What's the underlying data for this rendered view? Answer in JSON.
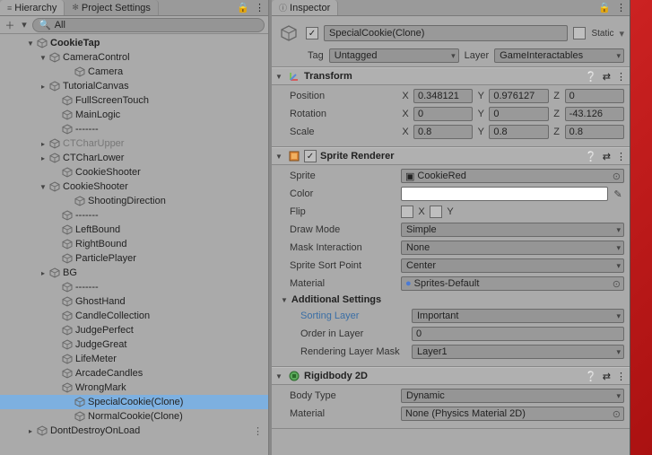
{
  "left": {
    "tab1": "Hierarchy",
    "tab2": "Project Settings",
    "search_placeholder": "All",
    "tree": [
      {
        "d": 2,
        "fold": "▼",
        "root": true,
        "icon": "cube",
        "label": "CookieTap",
        "dim": false,
        "sel": false,
        "dot": ""
      },
      {
        "d": 3,
        "fold": "▼",
        "root": false,
        "icon": "cube",
        "label": "CameraControl",
        "dim": false,
        "sel": false,
        "dot": ""
      },
      {
        "d": 5,
        "fold": "",
        "root": false,
        "icon": "cube",
        "label": "Camera",
        "dim": false,
        "sel": false,
        "dot": ""
      },
      {
        "d": 3,
        "fold": "▸",
        "root": false,
        "icon": "cube",
        "label": "TutorialCanvas",
        "dim": false,
        "sel": false,
        "dot": ""
      },
      {
        "d": 4,
        "fold": "",
        "root": false,
        "icon": "cube",
        "label": "FullScreenTouch",
        "dim": false,
        "sel": false,
        "dot": ""
      },
      {
        "d": 4,
        "fold": "",
        "root": false,
        "icon": "cube",
        "label": "MainLogic",
        "dim": false,
        "sel": false,
        "dot": ""
      },
      {
        "d": 4,
        "fold": "",
        "root": false,
        "icon": "cube",
        "label": "-------",
        "dim": false,
        "sel": false,
        "dot": ""
      },
      {
        "d": 3,
        "fold": "▸",
        "root": false,
        "icon": "cube",
        "label": "CTCharUpper",
        "dim": true,
        "sel": false,
        "dot": ""
      },
      {
        "d": 3,
        "fold": "▸",
        "root": false,
        "icon": "cube",
        "label": "CTCharLower",
        "dim": false,
        "sel": false,
        "dot": ""
      },
      {
        "d": 4,
        "fold": "",
        "root": false,
        "icon": "cube",
        "label": "CookieShooter",
        "dim": false,
        "sel": false,
        "dot": ""
      },
      {
        "d": 3,
        "fold": "▼",
        "root": false,
        "icon": "cube",
        "label": "CookieShooter",
        "dim": false,
        "sel": false,
        "dot": ""
      },
      {
        "d": 5,
        "fold": "",
        "root": false,
        "icon": "cube",
        "label": "ShootingDirection",
        "dim": false,
        "sel": false,
        "dot": ""
      },
      {
        "d": 4,
        "fold": "",
        "root": false,
        "icon": "cube",
        "label": "-------",
        "dim": false,
        "sel": false,
        "dot": ""
      },
      {
        "d": 4,
        "fold": "",
        "root": false,
        "icon": "cube",
        "label": "LeftBound",
        "dim": false,
        "sel": false,
        "dot": ""
      },
      {
        "d": 4,
        "fold": "",
        "root": false,
        "icon": "cube",
        "label": "RightBound",
        "dim": false,
        "sel": false,
        "dot": ""
      },
      {
        "d": 4,
        "fold": "",
        "root": false,
        "icon": "cube",
        "label": "ParticlePlayer",
        "dim": false,
        "sel": false,
        "dot": ""
      },
      {
        "d": 3,
        "fold": "▸",
        "root": false,
        "icon": "cube",
        "label": "BG",
        "dim": false,
        "sel": false,
        "dot": ""
      },
      {
        "d": 4,
        "fold": "",
        "root": false,
        "icon": "cube",
        "label": "-------",
        "dim": false,
        "sel": false,
        "dot": ""
      },
      {
        "d": 4,
        "fold": "",
        "root": false,
        "icon": "cube",
        "label": "GhostHand",
        "dim": false,
        "sel": false,
        "dot": ""
      },
      {
        "d": 4,
        "fold": "",
        "root": false,
        "icon": "cube",
        "label": "CandleCollection",
        "dim": false,
        "sel": false,
        "dot": ""
      },
      {
        "d": 4,
        "fold": "",
        "root": false,
        "icon": "cube",
        "label": "JudgePerfect",
        "dim": false,
        "sel": false,
        "dot": ""
      },
      {
        "d": 4,
        "fold": "",
        "root": false,
        "icon": "cube",
        "label": "JudgeGreat",
        "dim": false,
        "sel": false,
        "dot": ""
      },
      {
        "d": 4,
        "fold": "",
        "root": false,
        "icon": "cube",
        "label": "LifeMeter",
        "dim": false,
        "sel": false,
        "dot": ""
      },
      {
        "d": 4,
        "fold": "",
        "root": false,
        "icon": "cube",
        "label": "ArcadeCandles",
        "dim": false,
        "sel": false,
        "dot": ""
      },
      {
        "d": 4,
        "fold": "",
        "root": false,
        "icon": "cube",
        "label": "WrongMark",
        "dim": false,
        "sel": false,
        "dot": ""
      },
      {
        "d": 5,
        "fold": "",
        "root": false,
        "icon": "cube",
        "label": "SpecialCookie(Clone)",
        "dim": false,
        "sel": true,
        "dot": ""
      },
      {
        "d": 5,
        "fold": "",
        "root": false,
        "icon": "cube",
        "label": "NormalCookie(Clone)",
        "dim": false,
        "sel": false,
        "dot": ""
      },
      {
        "d": 2,
        "fold": "▸",
        "root": false,
        "icon": "cube",
        "label": "DontDestroyOnLoad",
        "dim": false,
        "sel": false,
        "dot": "⋮"
      }
    ]
  },
  "inspector": {
    "tab": "Inspector",
    "active": true,
    "name": "SpecialCookie(Clone)",
    "static_label": "Static",
    "tag_label": "Tag",
    "tag_value": "Untagged",
    "layer_label": "Layer",
    "layer_value": "GameInteractables",
    "transform": {
      "title": "Transform",
      "position_label": "Position",
      "pos": {
        "x": "0.348121",
        "y": "0.976127",
        "z": "0"
      },
      "rotation_label": "Rotation",
      "rot": {
        "x": "0",
        "y": "0",
        "z": "-43.126"
      },
      "scale_label": "Scale",
      "scl": {
        "x": "0.8",
        "y": "0.8",
        "z": "0.8"
      }
    },
    "sprite": {
      "title": "Sprite Renderer",
      "sprite_label": "Sprite",
      "sprite_value": "CookieRed",
      "color_label": "Color",
      "flip_label": "Flip",
      "flip_x": "X",
      "flip_y": "Y",
      "drawmode_label": "Draw Mode",
      "drawmode_value": "Simple",
      "mask_label": "Mask Interaction",
      "mask_value": "None",
      "sort_label": "Sprite Sort Point",
      "sort_value": "Center",
      "mat_label": "Material",
      "mat_value": "Sprites-Default",
      "additional_label": "Additional Settings",
      "sorting_layer_label": "Sorting Layer",
      "sorting_layer_value": "Important",
      "order_label": "Order in Layer",
      "order_value": "0",
      "rendering_mask_label": "Rendering Layer Mask",
      "rendering_mask_value": "Layer1"
    },
    "rigidbody": {
      "title": "Rigidbody 2D",
      "body_label": "Body Type",
      "body_value": "Dynamic",
      "mat_label": "Material",
      "mat_value": "None (Physics Material 2D)"
    }
  }
}
